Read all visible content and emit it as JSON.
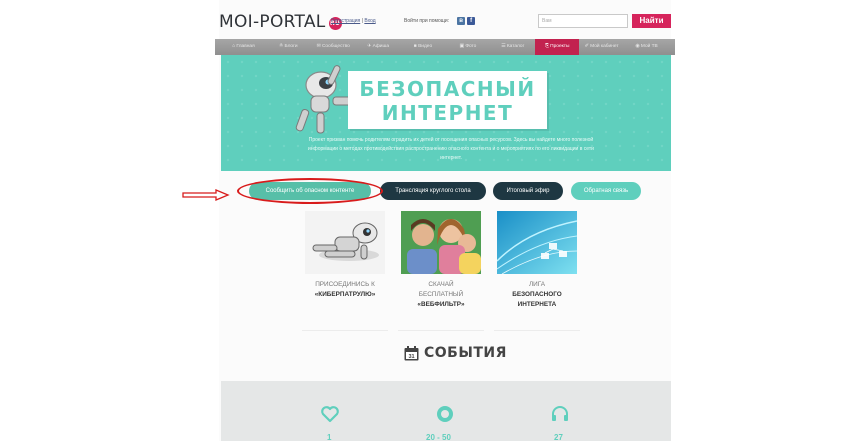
{
  "header": {
    "logo_text": "MOI-PORTAL",
    "logo_badge": "RU",
    "register_label": "Регистрация",
    "separator": "|",
    "login_label": "Вход",
    "social_login_label": "Войти при помощи:",
    "social_icons": [
      "vk-icon",
      "facebook-icon"
    ],
    "search_placeholder": "Вам",
    "search_button": "Найти"
  },
  "nav": {
    "items": [
      {
        "label": "⌂ Главная",
        "active": false
      },
      {
        "label": "≗ Блоги",
        "active": false
      },
      {
        "label": "✉ Сообщество",
        "active": false
      },
      {
        "label": "✈ Афиша",
        "active": false
      },
      {
        "label": "■ Видео",
        "active": false
      },
      {
        "label": "▣ Фото",
        "active": false
      },
      {
        "label": "☰ Каталог",
        "active": false
      },
      {
        "label": "⎘ Проекты",
        "active": true
      },
      {
        "label": "✐ Мой кабинет",
        "active": false
      },
      {
        "label": "◉ Мой ТВ",
        "active": false
      }
    ]
  },
  "banner": {
    "title_line1": "БЕЗОПАСНЫЙ",
    "title_line2": "ИНТЕРНЕТ",
    "description": "Проект призван помочь родителям оградить их детей от посещения опасных ресурсов. Здесь вы найдете много полезной информации о методах противодействия распространению опасного контента и о мероприятиях по его ликвидации в сети интернет."
  },
  "actions": {
    "report": "Сообщить об опасном контенте",
    "stream": "Трансляция круглого стола",
    "final": "Итоговый эфир",
    "feedback": "Обратная связь"
  },
  "cards": [
    {
      "line1": "ПРИСОЕДИНИСЬ К",
      "line2": "«КИБЕРПАТРУЛЮ»"
    },
    {
      "line1": "СКАЧАЙ",
      "line1b": "БЕСПЛАТНЫЙ",
      "line2": "«ВЕБФИЛЬТР»"
    },
    {
      "line1": "ЛИГА",
      "line1b": "БЕЗОПАСНОГО",
      "line2": "ИНТЕРНЕТА"
    }
  ],
  "events": {
    "title": "СОБЫТИЯ",
    "calendar_day": "31"
  },
  "stats": {
    "icons": [
      "heart-icon",
      "circle-icon",
      "headphones-icon"
    ],
    "numbers": [
      "1",
      "20 - 50",
      "27"
    ]
  },
  "colors": {
    "brand": "#d6245c",
    "teal": "#5fcfbd",
    "dark": "#1e3742",
    "annotation_red": "#d81b1b"
  }
}
